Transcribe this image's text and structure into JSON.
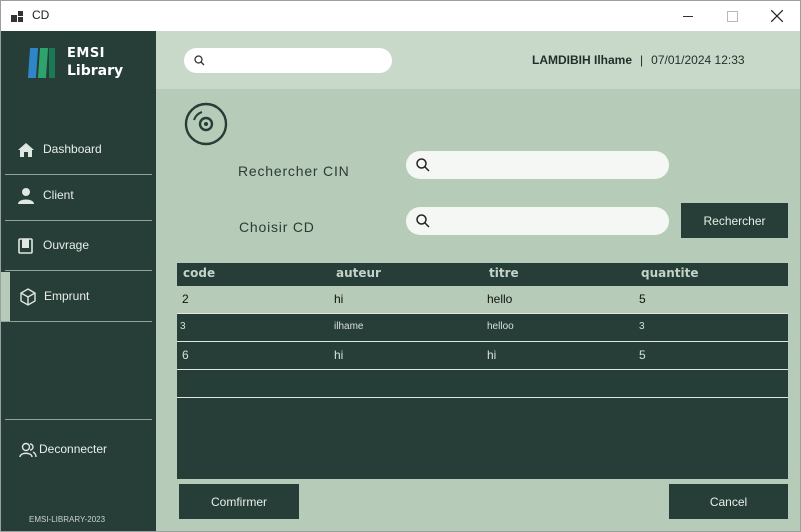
{
  "window": {
    "title": "CD"
  },
  "sidebar": {
    "logo_line1": "EMSI",
    "logo_line2": "Library",
    "items": [
      {
        "label": "Dashboard",
        "icon": "home-icon"
      },
      {
        "label": "Client",
        "icon": "user-icon"
      },
      {
        "label": "Ouvrage",
        "icon": "book-icon"
      },
      {
        "label": "Emprunt",
        "icon": "box-icon",
        "active": true
      }
    ],
    "logout_label": "Deconnecter",
    "footer": "EMSI-LIBRARY-2023"
  },
  "header": {
    "search_placeholder": "",
    "user_name": "LAMDIBIH Ilhame",
    "separator": "|",
    "datetime": "07/01/2024 12:33"
  },
  "form": {
    "cin_label": "Rechercher CIN",
    "cin_value": "",
    "cd_label": "Choisir CD",
    "cd_value": "",
    "search_button": "Rechercher"
  },
  "table": {
    "columns": [
      "code",
      "auteur",
      "titre",
      "quantite"
    ],
    "rows": [
      [
        "2",
        "hi",
        "hello",
        "5"
      ],
      [
        "3",
        "ilhame",
        "helloo",
        "3"
      ],
      [
        "6",
        "hi",
        "hi",
        "5"
      ]
    ]
  },
  "actions": {
    "confirm": "Comfirmer",
    "cancel": "Cancel"
  },
  "colors": {
    "sidebar": "#263e37",
    "background": "#b7ccb8",
    "header": "#c8d9c9",
    "logo_blue": "#2e86c8",
    "logo_green": "#2ea36e"
  }
}
